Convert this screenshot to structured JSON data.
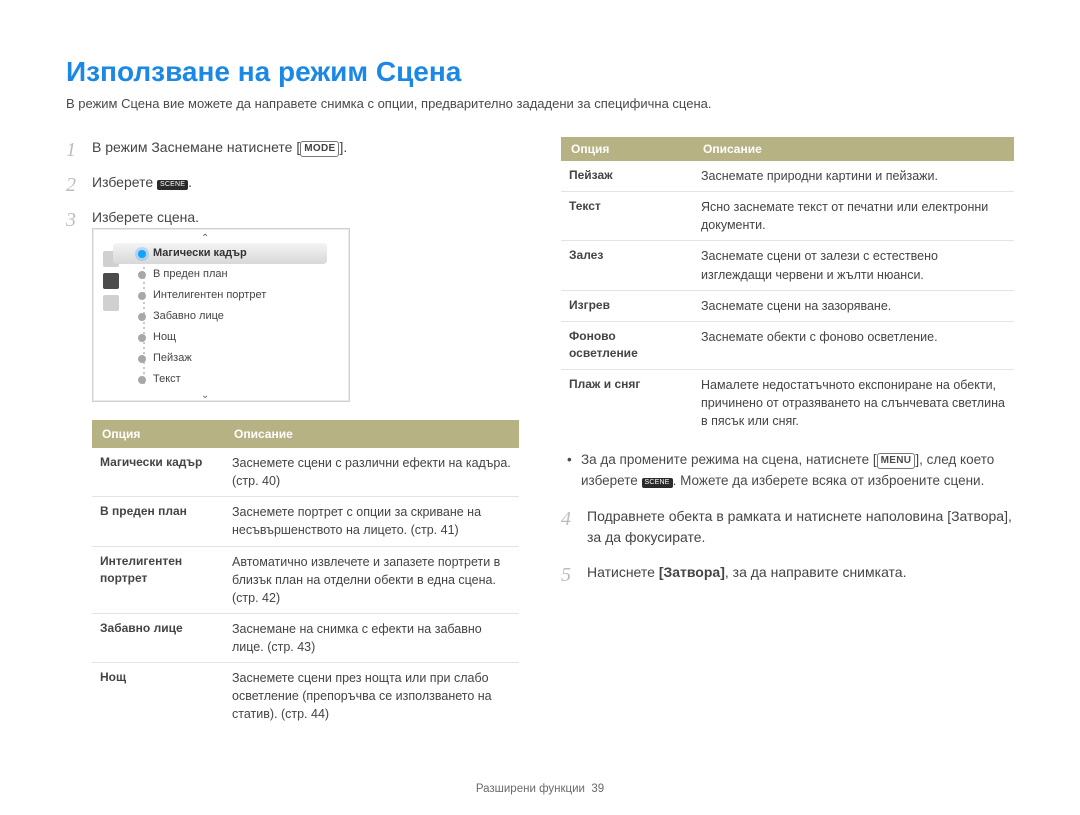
{
  "title": "Използване на режим Сцена",
  "intro": "В режим Сцена вие можете да направете снимка с опции, предварително зададени за специфична сцена.",
  "keys": {
    "mode": "MODE",
    "menu": "MENU",
    "scene_chip": "SCENE"
  },
  "steps": {
    "s1_pre": "В режим Заснемане натиснете ",
    "s1_post": ".",
    "s2_pre": "Изберете ",
    "s2_post": ".",
    "s3": "Изберете сцена.",
    "s4": "Подравнете обекта в рамката и натиснете наполовина [Затвора], за да фокусирате.",
    "s5_pre": "Натиснете ",
    "s5_shutter": "[Затвора]",
    "s5_post": ", за да направите снимката."
  },
  "bullet": {
    "pre": "За да промените режима на сцена, натиснете ",
    "mid": ", след което изберете ",
    "post": ". Можете да изберете всяка от изброените сцени."
  },
  "screenshot_menu": {
    "items": [
      "Магически кадър",
      "В преден план",
      "Интелигентен портрет",
      "Забавно лице",
      "Нощ",
      "Пейзаж",
      "Текст"
    ]
  },
  "table1": {
    "head_option": "Опция",
    "head_desc": "Описание",
    "rows": [
      {
        "opt": "Магически кадър",
        "desc": "Заснемете сцени с различни ефекти на кадъра. (стр. 40)"
      },
      {
        "opt": "В преден план",
        "desc": "Заснемете портрет с опции за скриване на несъвършенството на лицето. (стр. 41)"
      },
      {
        "opt": "Интелигентен портрет",
        "desc": "Автоматично извлечете и запазете портрети в близък план на отделни обекти в една сцена. (стр. 42)"
      },
      {
        "opt": "Забавно лице",
        "desc": "Заснемане на снимка с ефекти на забавно лице. (стр. 43)"
      },
      {
        "opt": "Нощ",
        "desc": "Заснемете сцени през нощта или при слабо осветление (препоръчва се използването на статив). (стр. 44)"
      }
    ]
  },
  "table2": {
    "head_option": "Опция",
    "head_desc": "Описание",
    "rows": [
      {
        "opt": "Пейзаж",
        "desc": "Заснемате природни картини и пейзажи."
      },
      {
        "opt": "Текст",
        "desc": "Ясно заснемате текст от печатни или електронни документи."
      },
      {
        "opt": "Залез",
        "desc": "Заснемате сцени от залези с естествено изглеждащи червени и жълти нюанси."
      },
      {
        "opt": "Изгрев",
        "desc": "Заснемате сцени на зазоряване."
      },
      {
        "opt": "Фоново осветление",
        "desc": "Заснемате обекти с фоново осветление."
      },
      {
        "opt": "Плаж и сняг",
        "desc": "Намалете недостатъчното експониране на обекти, причинено от отразяването на слънчевата светлина в пясък или сняг."
      }
    ]
  },
  "footer": {
    "section": "Разширени функции",
    "page": "39"
  }
}
